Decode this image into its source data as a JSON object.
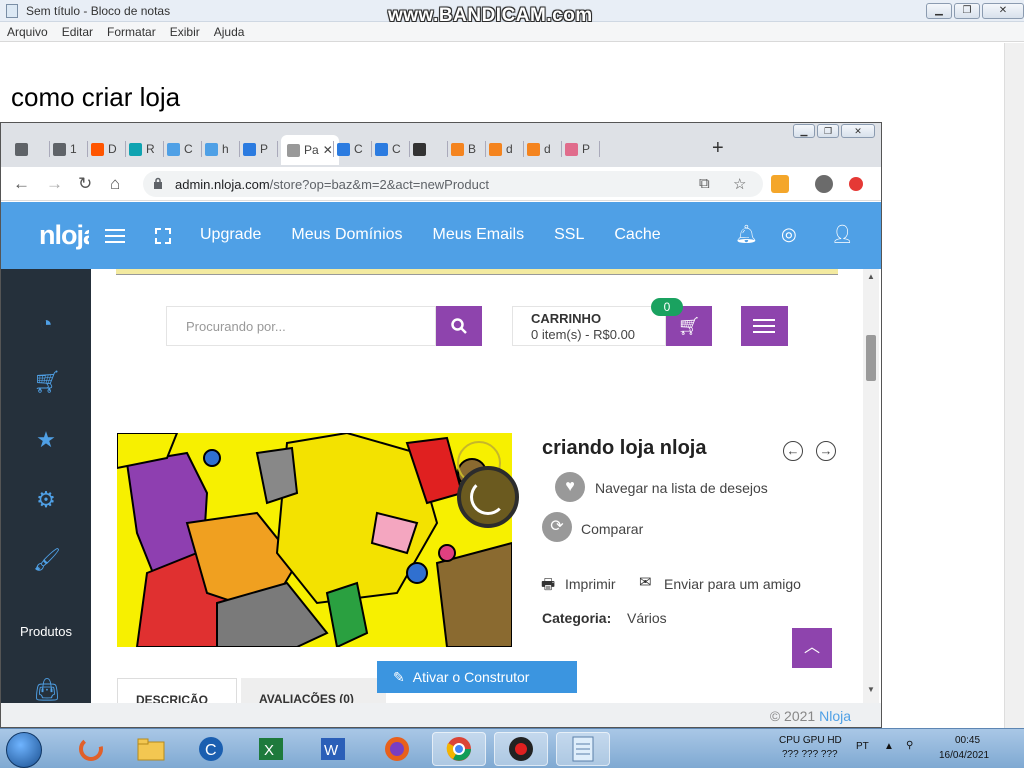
{
  "notepad": {
    "title": "Sem título - Bloco de notas",
    "menu": [
      "Arquivo",
      "Editar",
      "Formatar",
      "Exibir",
      "Ajuda"
    ],
    "line1": "como criar loja"
  },
  "watermark": "www.BANDICAM.com",
  "browser": {
    "tabs": [
      {
        "letter": "",
        "color": "#5f6368"
      },
      {
        "letter": "1",
        "color": "#5f6368"
      },
      {
        "letter": "D",
        "color": "#ff5500"
      },
      {
        "letter": "R",
        "color": "#0fa3b1"
      },
      {
        "letter": "C",
        "color": "#4fa0e6"
      },
      {
        "letter": "h",
        "color": "#4fa0e6"
      },
      {
        "letter": "P",
        "color": "#2b7be0"
      },
      {
        "letter": "Pa",
        "color": "#999999",
        "active": true
      },
      {
        "letter": "C",
        "color": "#2b7be0"
      },
      {
        "letter": "C",
        "color": "#2b7be0"
      },
      {
        "letter": "",
        "color": "#333333"
      },
      {
        "letter": "B",
        "color": "#f4841f"
      },
      {
        "letter": "d",
        "color": "#f4841f"
      },
      {
        "letter": "d",
        "color": "#f4841f"
      },
      {
        "letter": "P",
        "color": "#e06c8c"
      }
    ],
    "url_host": "admin.nloja.com",
    "url_path": "/store?op=baz&m=2&act=newProduct"
  },
  "app": {
    "logo": "nloja",
    "nav": [
      "Upgrade",
      "Meus Domínios",
      "Meus Emails",
      "SSL",
      "Cache"
    ],
    "sidebar_label": "Produtos",
    "search_placeholder": "Procurando por...",
    "cart_title": "CARRINHO",
    "cart_summary": "0 item(s) - R$0.00",
    "cart_count": "0",
    "product_title": "criando loja nloja",
    "wishlist": "Navegar na lista de desejos",
    "compare": "Comparar",
    "print": "Imprimir",
    "send_friend": "Enviar para um amigo",
    "category_label": "Categoria:",
    "category_value": "Vários",
    "tab_description": "DESCRIÇÃO",
    "tab_reviews": "AVALIAÇÕES (0)",
    "builder_button": "Ativar o Construtor",
    "footer_copy": "© 2021",
    "footer_link": "Nloja",
    "accent": "#4fa0e6",
    "purple": "#8e44ad"
  },
  "taskbar": {
    "tray_label": "CPU GPU HD",
    "tray_values": "??? ??? ???",
    "lang": "PT",
    "time": "00:45",
    "date": "16/04/2021"
  }
}
